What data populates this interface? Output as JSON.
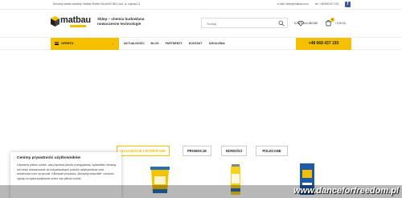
{
  "topbar": {
    "company_info": "Domowy rabnik-cookiedy: Matbau Robert Socha 90-562 Łódź, ul. Łąkowa 11",
    "email": "e-mail: sklep@matbau.com",
    "phone": "tel: +48 668 437 193",
    "facebook_glyph": "f"
  },
  "header": {
    "logo_text": "matbau",
    "tagline_line1": "Sklep – chemia budowlana",
    "tagline_line2": "nowoczesne technologie",
    "search_placeholder": "Szukaj",
    "account_label": "KONTO",
    "favorites_label": "ULUBIONE",
    "cart_count": "0",
    "cart_total": "/ 0,00 ZŁ"
  },
  "nav": {
    "offer_label": "OFERTA",
    "links": [
      "AKTUALNOŚCI",
      "BLOG",
      "PARTNERZY",
      "KONTAKT",
      "SZKOLENIA"
    ],
    "phone_button": "+48 668 437 193"
  },
  "products": {
    "tabs": [
      "NAJCZĘŚCIEJ WYBIERANE",
      "PROMOCJE",
      "NOWOŚCI",
      "POLECANE"
    ]
  },
  "cookie": {
    "title": "Cenimy prywatność użytkowników",
    "body": "Używamy plików cookie, aby poprawić jakość przeglądania, wyświetlać reklamy lub treści dostosowane do indywidualnych potrzeb użytkowników oraz analizować ruch na stronie. Kliknięcie przycisku „Akceptuj wszystkie” oznacza zgodę na wykorzystywanie przez nas plików cookie."
  },
  "watermark": "www.danceforfreedom.pl",
  "colors": {
    "accent": "#f6c000",
    "text": "#333333",
    "facebook": "#3b5998"
  }
}
